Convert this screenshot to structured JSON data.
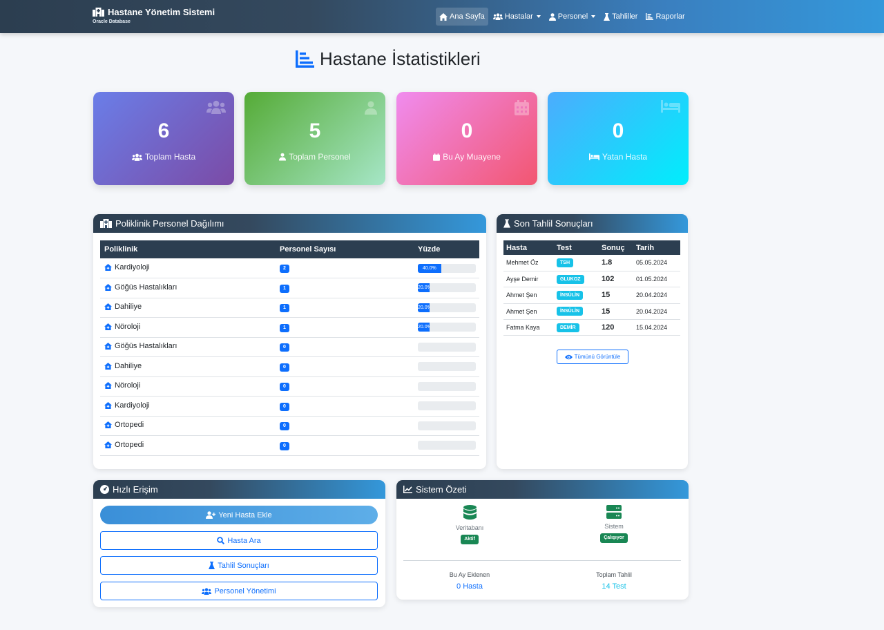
{
  "navbar": {
    "brand_title": "Hastane Yönetim Sistemi",
    "brand_sub": "Oracle Database",
    "items": [
      {
        "label": "Ana Sayfa"
      },
      {
        "label": "Hastalar"
      },
      {
        "label": "Personel"
      },
      {
        "label": "Tahliller"
      },
      {
        "label": "Raporlar"
      }
    ]
  },
  "page": {
    "title": "Hastane İstatistikleri"
  },
  "stats": [
    {
      "value": "6",
      "label": "Toplam Hasta"
    },
    {
      "value": "5",
      "label": "Toplam Personel"
    },
    {
      "value": "0",
      "label": "Bu Ay Muayene"
    },
    {
      "value": "0",
      "label": "Yatan Hasta"
    }
  ],
  "clinics": {
    "title": "Poliklinik Personel Dağılımı",
    "headers": [
      "Poliklinik",
      "Personel Sayısı",
      "Yüzde"
    ],
    "rows": [
      {
        "name": "Kardiyoloji",
        "count": "2",
        "pct": 40.0,
        "pct_label": "40.0%"
      },
      {
        "name": "Göğüs Hastalıkları",
        "count": "1",
        "pct": 20.0,
        "pct_label": "20.0%"
      },
      {
        "name": "Dahiliye",
        "count": "1",
        "pct": 20.0,
        "pct_label": "20.0%"
      },
      {
        "name": "Nöroloji",
        "count": "1",
        "pct": 20.0,
        "pct_label": "20.0%"
      },
      {
        "name": "Göğüs Hastalıkları",
        "count": "0",
        "pct": 0,
        "pct_label": ""
      },
      {
        "name": "Dahiliye",
        "count": "0",
        "pct": 0,
        "pct_label": ""
      },
      {
        "name": "Nöroloji",
        "count": "0",
        "pct": 0,
        "pct_label": ""
      },
      {
        "name": "Kardiyoloji",
        "count": "0",
        "pct": 0,
        "pct_label": ""
      },
      {
        "name": "Ortopedi",
        "count": "0",
        "pct": 0,
        "pct_label": ""
      },
      {
        "name": "Ortopedi",
        "count": "0",
        "pct": 0,
        "pct_label": ""
      }
    ]
  },
  "labs": {
    "title": "Son Tahlil Sonuçları",
    "headers": [
      "Hasta",
      "Test",
      "Sonuç",
      "Tarih"
    ],
    "rows": [
      {
        "patient": "Mehmet Öz",
        "test": "TSH",
        "result": "1.8",
        "date": "05.05.2024"
      },
      {
        "patient": "Ayşe Demir",
        "test": "GLUKOZ",
        "result": "102",
        "date": "01.05.2024"
      },
      {
        "patient": "Ahmet Şen",
        "test": "İNSÜLİN",
        "result": "15",
        "date": "20.04.2024"
      },
      {
        "patient": "Ahmet Şen",
        "test": "İNSÜLİN",
        "result": "15",
        "date": "20.04.2024"
      },
      {
        "patient": "Fatma Kaya",
        "test": "DEMİR",
        "result": "120",
        "date": "15.04.2024"
      }
    ],
    "view_all": "Tümünü Görüntüle"
  },
  "quick": {
    "title": "Hızlı Erişim",
    "buttons": [
      "Yeni Hasta Ekle",
      "Hasta Ara",
      "Tahlil Sonuçları",
      "Personel Yönetimi"
    ]
  },
  "system": {
    "title": "Sistem Özeti",
    "db_label": "Veritabanı",
    "db_status": "Aktif",
    "sys_label": "Sistem",
    "sys_status": "Çalışıyor",
    "month_label": "Bu Ay Eklenen",
    "month_value": "0 Hasta",
    "tests_label": "Toplam Tahlil",
    "tests_value": "14 Test"
  },
  "colors": {
    "primary": "#0d6efd",
    "info": "#17c2e8",
    "success": "#198754",
    "dark": "#2c3e50"
  }
}
